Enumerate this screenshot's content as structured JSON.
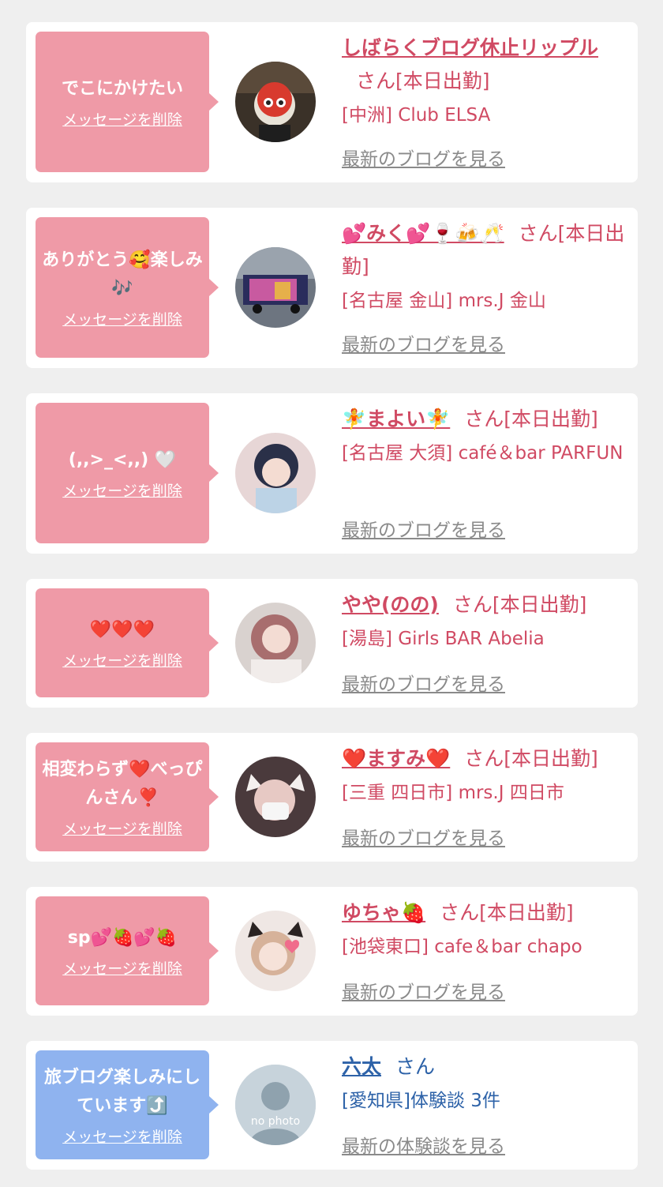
{
  "delete_label": "メッセージを削除",
  "san_label": "さん",
  "cards": [
    {
      "message": "でこにかけたい",
      "name": "しばらくブログ休止リップル",
      "suffix": "さん[本日出勤]",
      "shop": "[中洲] Club ELSA",
      "link": "最新のブログを見る"
    },
    {
      "message": "ありがとう🥰楽しみ🎶",
      "name": "💕みく💕🍷🍻🥂",
      "suffix": "さん[本日出勤]",
      "shop": "[名古屋 金山] mrs.J 金山",
      "link": "最新のブログを見る"
    },
    {
      "message": "(,,>_<,,) 🤍",
      "name": "🧚まよい🧚",
      "suffix": "さん[本日出勤]",
      "shop": "[名古屋 大須] café＆bar PARFUN",
      "link": "最新のブログを見る"
    },
    {
      "message": "❤️❤️❤️",
      "name": "やや(のの)",
      "suffix": "さん[本日出勤]",
      "shop": "[湯島] Girls BAR Abelia",
      "link": "最新のブログを見る"
    },
    {
      "message": "相変わらず❤️べっぴんさん❣️",
      "name": "❤️ますみ❤️",
      "suffix": "さん[本日出勤]",
      "shop": "[三重 四日市] mrs.J 四日市",
      "link": "最新のブログを見る"
    },
    {
      "message": "sp💕🍓💕🍓",
      "name": "ゆちゃ🍓",
      "suffix": "さん[本日出勤]",
      "shop": "[池袋東口] cafe＆bar chapo",
      "link": "最新のブログを見る"
    },
    {
      "message": "旅ブログ楽しみにしています⤴️",
      "name": "六太",
      "suffix": "さん",
      "shop": "[愛知県]体験談 3件",
      "link": "最新の体験談を見る",
      "avatar_text": "no photo"
    }
  ],
  "colors": {
    "background": "#efefef",
    "bubble_pink": "#ef9aa7",
    "bubble_blue": "#8fb3ef",
    "text_pink": "#d04a63",
    "text_blue": "#2d62a8",
    "link_gray": "#8a8a8a"
  },
  "icons": [
    "avatar-photo",
    "no-photo-silhouette-icon"
  ]
}
